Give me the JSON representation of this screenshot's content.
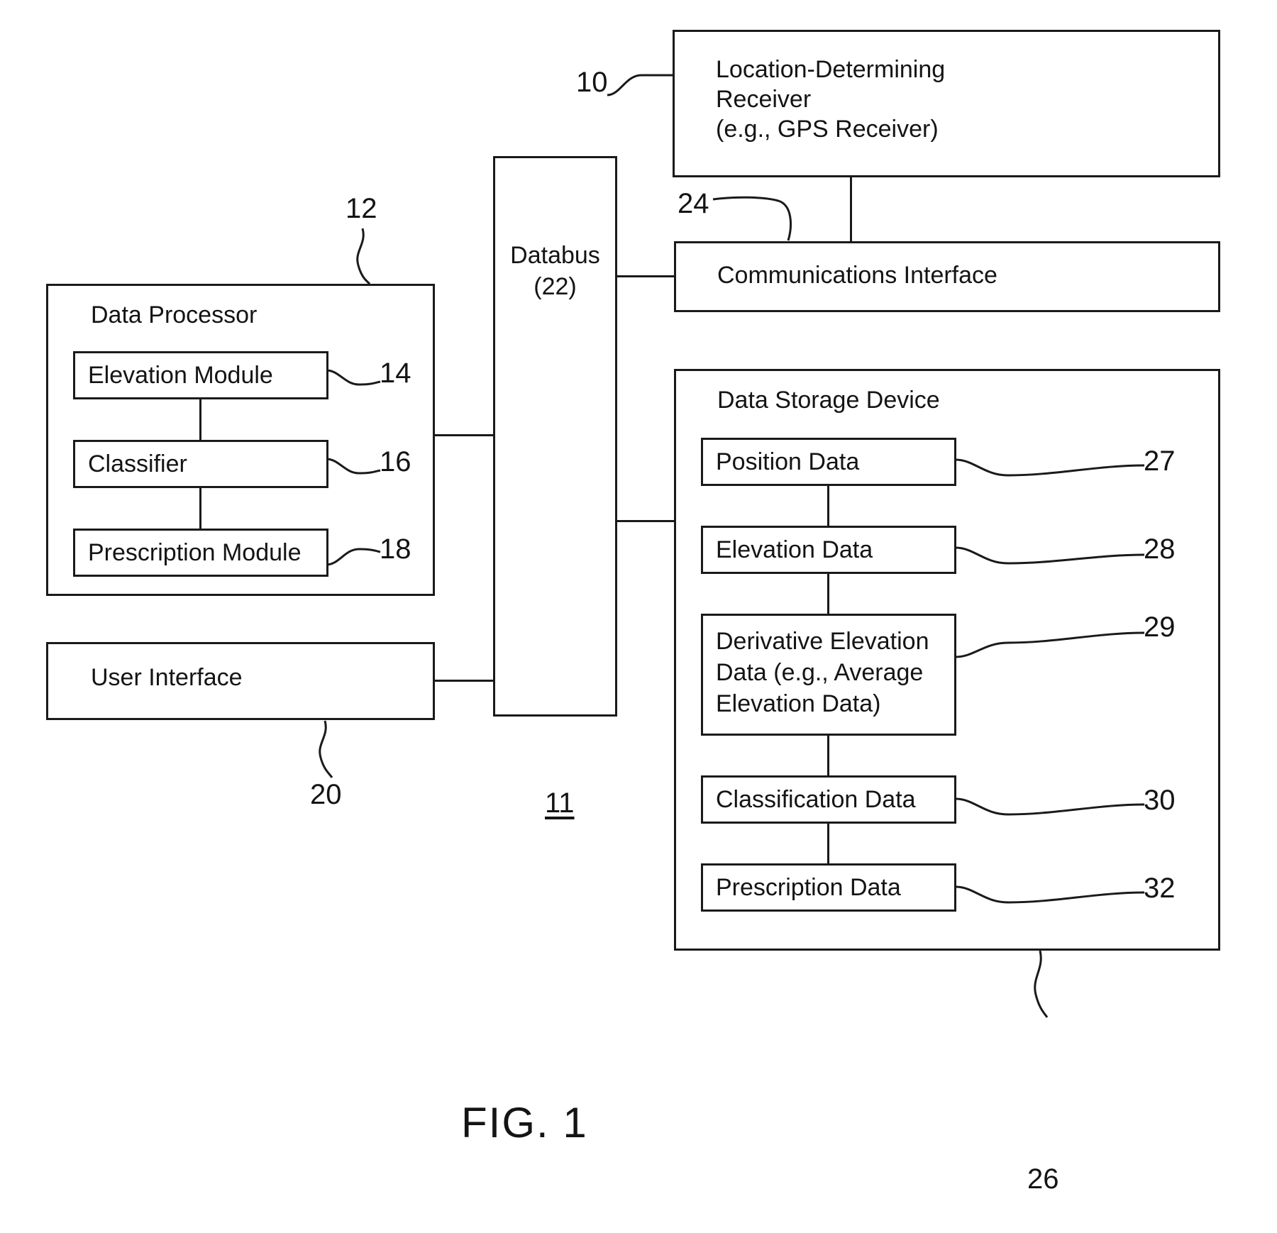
{
  "figure": {
    "label": "FIG. 1",
    "system_ref": "11"
  },
  "blocks": {
    "location_receiver": {
      "title": "Location-Determining\nReceiver\n(e.g., GPS Receiver)",
      "ref": "10"
    },
    "communications_interface": {
      "title": "Communications Interface",
      "ref": "24"
    },
    "databus": {
      "title": "Databus",
      "ref_paren": "(22)"
    },
    "data_processor": {
      "title": "Data Processor",
      "ref": "12",
      "modules": [
        {
          "label": "Elevation Module",
          "ref": "14"
        },
        {
          "label": "Classifier",
          "ref": "16"
        },
        {
          "label": "Prescription Module",
          "ref": "18"
        }
      ]
    },
    "user_interface": {
      "title": "User Interface",
      "ref": "20"
    },
    "data_storage_device": {
      "title": "Data Storage Device",
      "ref": "26",
      "items": [
        {
          "label": "Position Data",
          "ref": "27"
        },
        {
          "label": "Elevation Data",
          "ref": "28"
        },
        {
          "label": "Derivative Elevation\nData (e.g., Average\nElevation Data)",
          "ref": "29"
        },
        {
          "label": "Classification Data",
          "ref": "30"
        },
        {
          "label": "Prescription Data",
          "ref": "32"
        }
      ]
    }
  }
}
